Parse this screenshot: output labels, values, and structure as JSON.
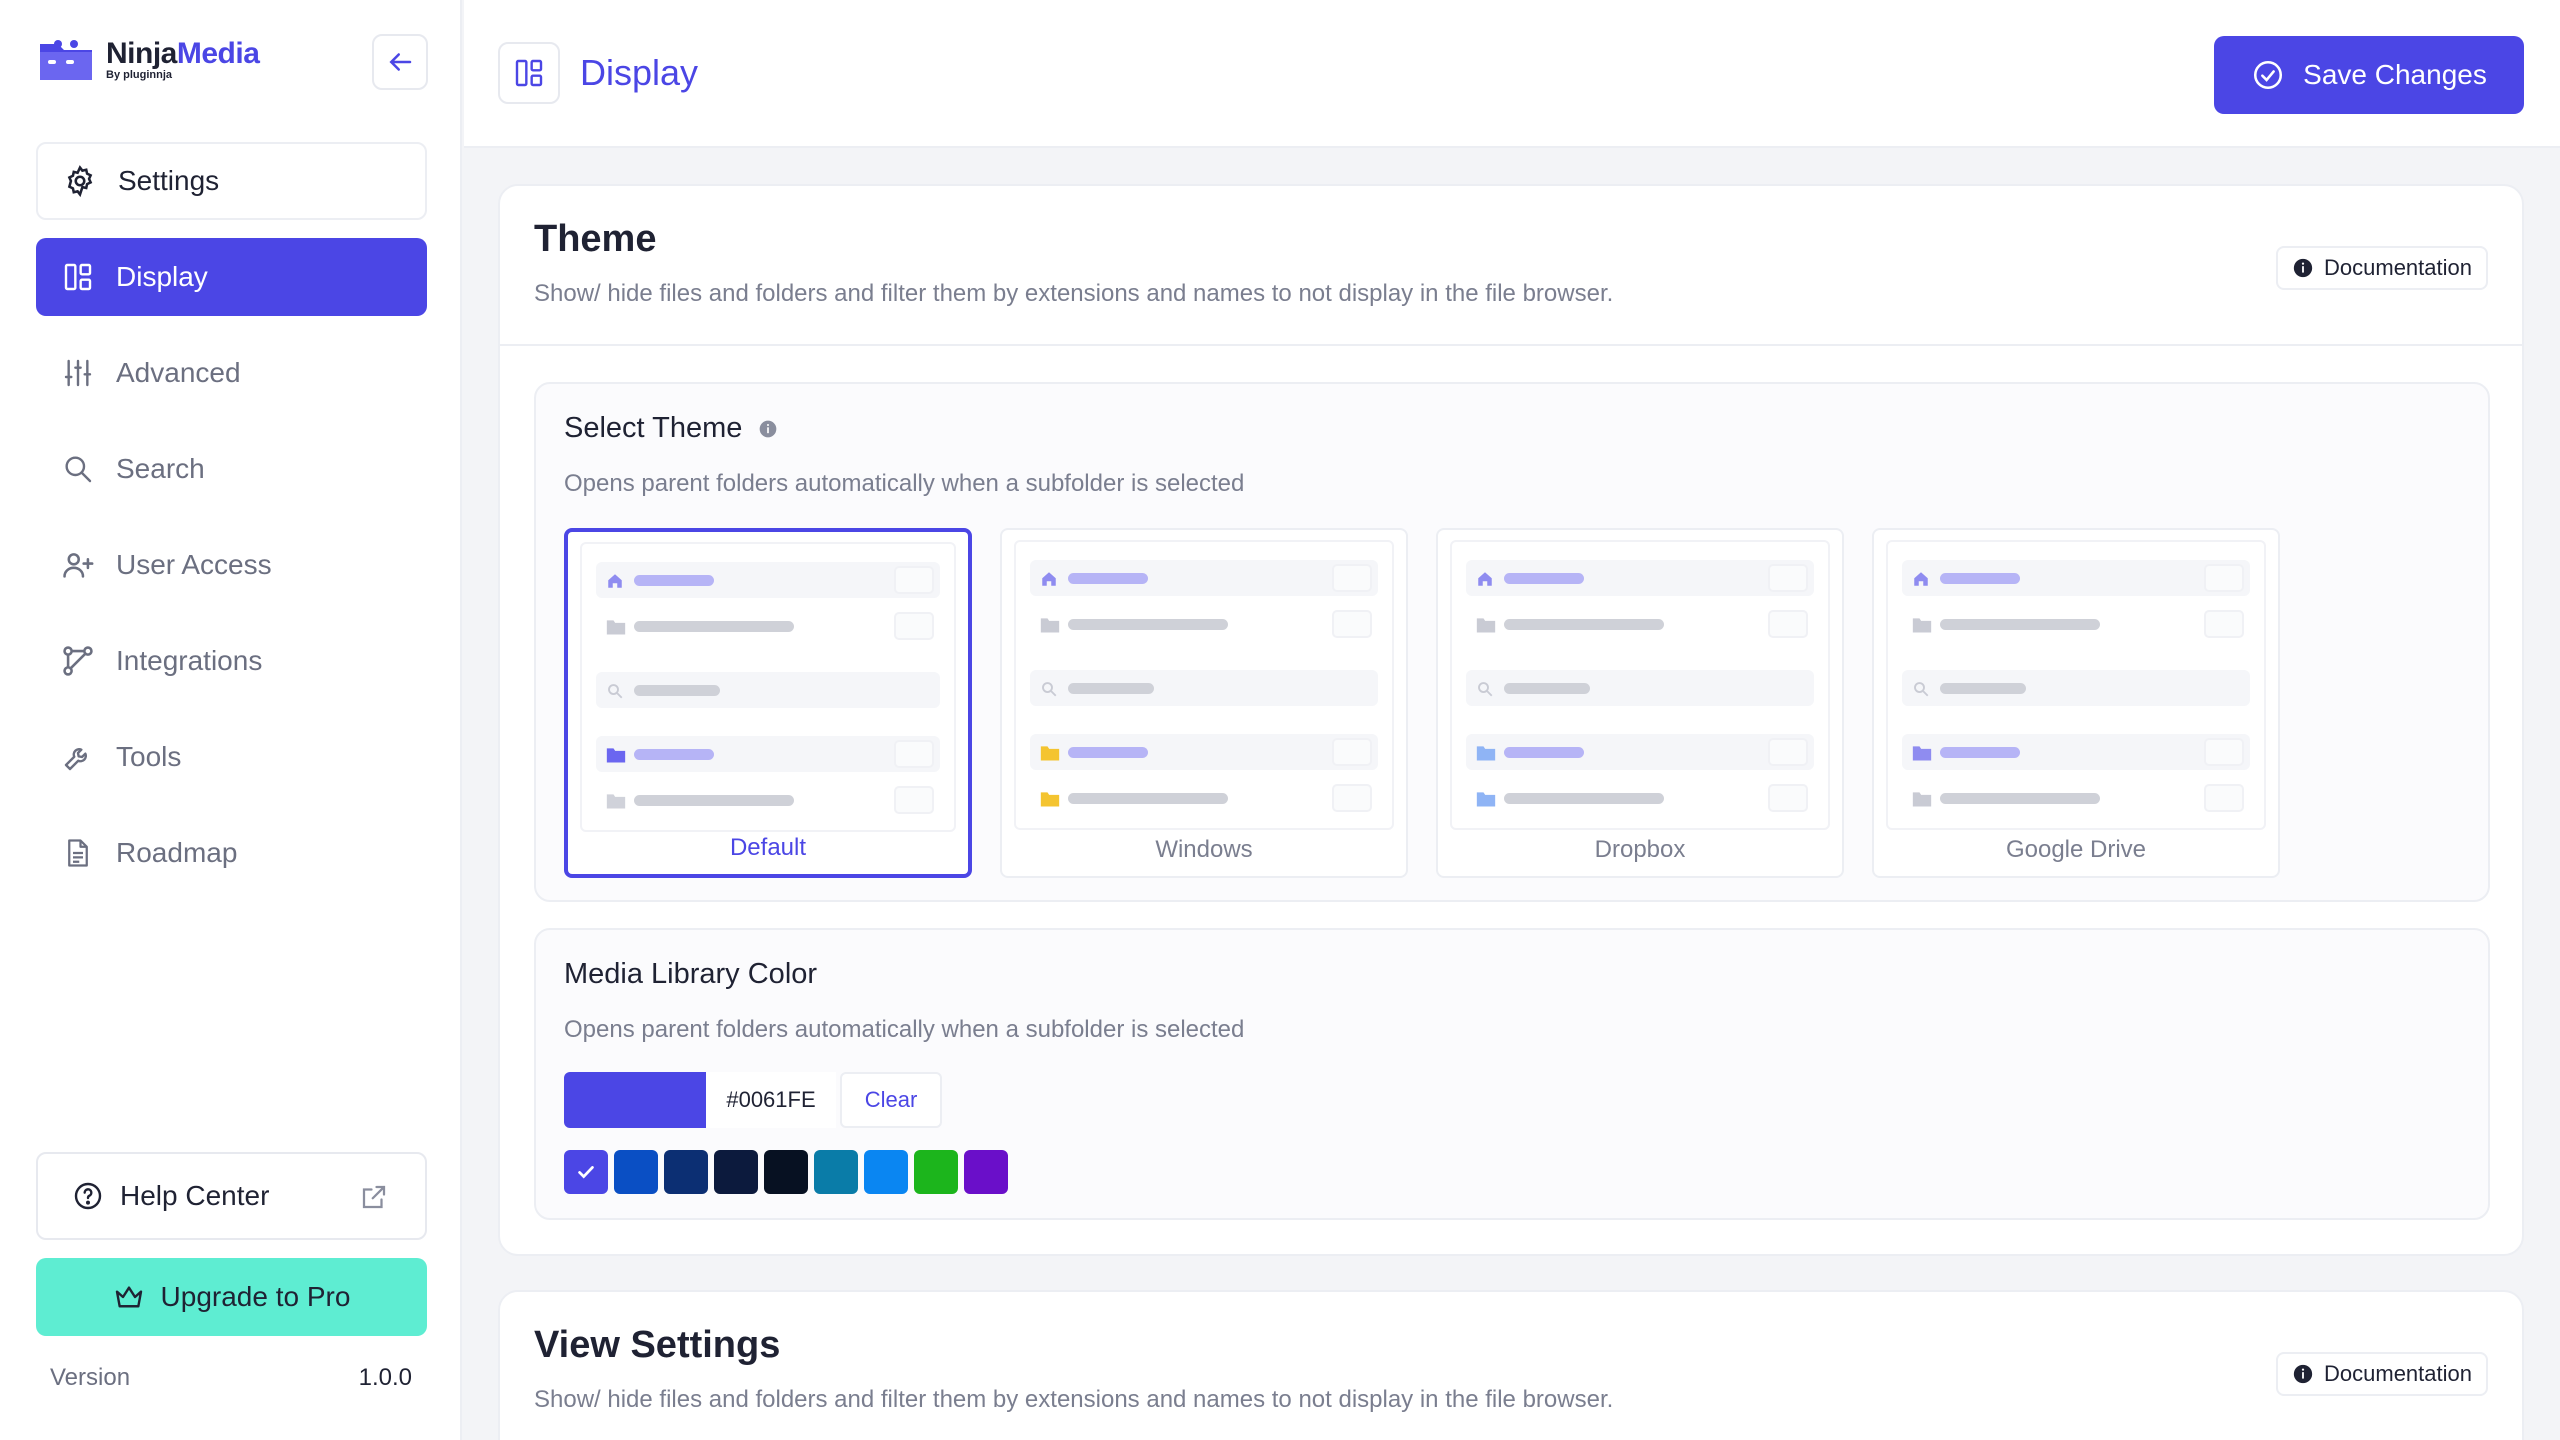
{
  "brand": {
    "name_part1": "Ninja",
    "name_part2": "Media",
    "byline": "By pluginnja"
  },
  "sidebar": {
    "items": [
      {
        "label": "Settings",
        "icon": "gear-icon"
      },
      {
        "label": "Display",
        "icon": "layout-icon"
      },
      {
        "label": "Advanced",
        "icon": "sliders-icon"
      },
      {
        "label": "Search",
        "icon": "search-icon"
      },
      {
        "label": "User Access",
        "icon": "users-icon"
      },
      {
        "label": "Integrations",
        "icon": "integrations-icon"
      },
      {
        "label": "Tools",
        "icon": "wrench-icon"
      },
      {
        "label": "Roadmap",
        "icon": "document-icon"
      }
    ],
    "help_label": "Help Center",
    "upgrade_label": "Upgrade to Pro",
    "version_label": "Version",
    "version_value": "1.0.0"
  },
  "header": {
    "title": "Display",
    "save_label": "Save Changes"
  },
  "theme_card": {
    "title": "Theme",
    "description": "Show/ hide files and folders and filter them by extensions and names to not display in the file browser.",
    "doc_label": "Documentation",
    "select_theme": {
      "title": "Select Theme",
      "description": "Opens parent folders automatically when a subfolder is selected",
      "options": [
        {
          "label": "Default",
          "selected": true
        },
        {
          "label": "Windows",
          "selected": false
        },
        {
          "label": "Dropbox",
          "selected": false
        },
        {
          "label": "Google Drive",
          "selected": false
        }
      ]
    },
    "media_color": {
      "title": "Media Library Color",
      "description": "Opens parent folders automatically when a subfolder is selected",
      "hex": "#0061FE",
      "clear_label": "Clear",
      "presets": [
        "#4b46e5",
        "#0a4fc4",
        "#0c2f73",
        "#0c1a3d",
        "#071122",
        "#0a7ca8",
        "#0a86f2",
        "#1cb51c",
        "#6a0fc9"
      ]
    }
  },
  "view_card": {
    "title": "View Settings",
    "description": "Show/ hide files and folders and filter them by extensions and names to not display in the file browser.",
    "doc_label": "Documentation"
  },
  "colors": {
    "accent": "#4b46e5",
    "upgrade": "#5eedd2"
  }
}
